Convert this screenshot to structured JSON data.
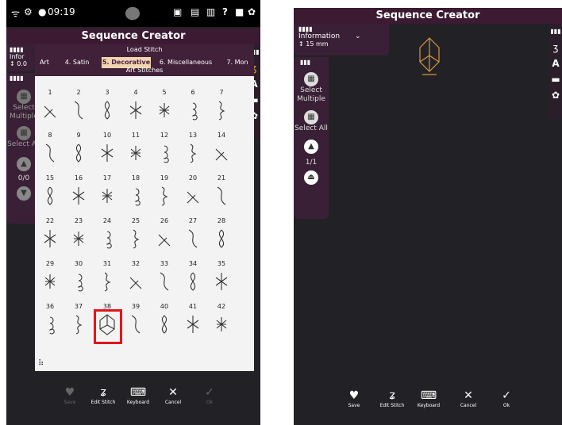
{
  "left": {
    "status": {
      "time": "09:19"
    },
    "title": "Sequence Creator",
    "info": {
      "label": "Infor",
      "size": "0.0"
    },
    "side": {
      "select_multiple": "Select Multiple",
      "select_all": "Select All",
      "counter": "0/0"
    },
    "dialog": {
      "title": "Load Stitch",
      "tabs": [
        "Art",
        "4. Satin",
        "5. Decorative",
        "6. Miscellaneous",
        "7. Mon"
      ],
      "active_tab": "5. Decorative",
      "subtitle": "Art Stitches",
      "numbers": [
        [
          "1",
          "2",
          "3",
          "4",
          "5",
          "6",
          "7"
        ],
        [
          "8",
          "9",
          "10",
          "11",
          "12",
          "13",
          "14"
        ],
        [
          "15",
          "16",
          "17",
          "18",
          "19",
          "20",
          "21"
        ],
        [
          "22",
          "23",
          "24",
          "25",
          "26",
          "27",
          "28"
        ],
        [
          "29",
          "30",
          "31",
          "32",
          "33",
          "34",
          "35"
        ],
        [
          "36",
          "37",
          "38",
          "39",
          "40",
          "41",
          "42"
        ]
      ],
      "selected": "38"
    },
    "bottom": {
      "save": "Save",
      "edit": "Edit Stitch",
      "keyboard": "Keyboard",
      "cancel": "Cancel",
      "ok": "Ok"
    }
  },
  "right": {
    "title": "Sequence Creator",
    "info": {
      "label": "Information",
      "size": "15 mm"
    },
    "side": {
      "select_multiple": "Select Multiple",
      "select_all": "Select All",
      "counter": "1/1"
    },
    "bottom": {
      "save": "Save",
      "edit": "Edit Stitch",
      "keyboard": "Keyboard",
      "cancel": "Cancel",
      "ok": "Ok"
    }
  },
  "colors": {
    "accent": "#4a2140",
    "selection": "#e0151b",
    "tab_active": "#f2d5b0",
    "stitch_preview": "#d9963a"
  }
}
